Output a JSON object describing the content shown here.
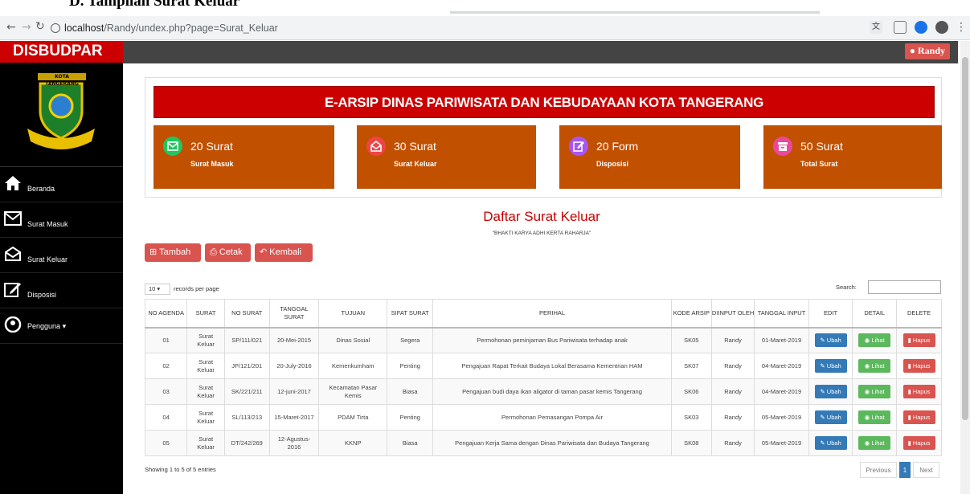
{
  "doc_heading": "D. Tampilan Surat Keluar",
  "browser": {
    "url_host": "localhost",
    "url_path": "/Randy/undex.php?page=Surat_Keluar"
  },
  "app": {
    "brand": "DISBUDPAR",
    "logo_text": "KOTA TANGERANG",
    "user_button": "Randy",
    "colors": {
      "brand": "#cc0000",
      "stat_card": "#c15000",
      "sidebar": "#000000",
      "topbar": "#444444"
    }
  },
  "sidebar": {
    "items": [
      {
        "label": "Beranda",
        "icon": "home-icon"
      },
      {
        "label": "Surat Masuk",
        "icon": "envelope-icon"
      },
      {
        "label": "Surat Keluar",
        "icon": "envelope-open-icon"
      },
      {
        "label": "Disposisi",
        "icon": "edit-icon"
      },
      {
        "label": "Pengguna",
        "icon": "user-circle-icon",
        "caret": "▾"
      }
    ]
  },
  "banner": "E-ARSIP DINAS PARIWISATA DAN KEBUDAYAAN KOTA TANGERANG",
  "stats": [
    {
      "count": "20 Surat",
      "label": "Surat Masuk",
      "icon": "envelope-icon",
      "color": "#22c55e"
    },
    {
      "count": "30 Surat",
      "label": "Surat Keluar",
      "icon": "envelope-open-icon",
      "color": "#ef4444"
    },
    {
      "count": "20 Form",
      "label": "Disposisi",
      "icon": "edit-icon",
      "color": "#a855f7"
    },
    {
      "count": "50 Surat",
      "label": "Total Surat",
      "icon": "archive-icon",
      "color": "#ec4899"
    }
  ],
  "page": {
    "title": "Daftar Surat Keluar",
    "subtitle": "\"BHAKTI KARYA ADHI KERTA RAHARJA\""
  },
  "actions": {
    "add": "Tambah",
    "print": "Cetak",
    "back": "Kembali"
  },
  "table_controls": {
    "page_size": "10",
    "records_label": "records per page",
    "search_label": "Search:"
  },
  "table": {
    "headers": [
      "NO AGENDA",
      "SURAT",
      "NO SURAT",
      "TANGGAL SURAT",
      "TUJUAN",
      "SIFAT SURAT",
      "PERIHAL",
      "KODE ARSIP",
      "DIINPUT OLEH",
      "TANGGAL INPUT",
      "EDIT",
      "DETAIL",
      "DELETE"
    ],
    "rows": [
      {
        "no": "01",
        "surat": "Surat Keluar",
        "no_surat": "SP/111/021",
        "tanggal": "20-Mei-2015",
        "tujuan": "Dinas Sosial",
        "sifat": "Segera",
        "perihal": "Permohonan peminjaman Bus Pariwisata terhadap anak",
        "kode": "SK05",
        "oleh": "Randy",
        "input": "01-Maret-2019"
      },
      {
        "no": "02",
        "surat": "Surat Keluar",
        "no_surat": "JP/121/201",
        "tanggal": "20-July-2016",
        "tujuan": "Kemenkumham",
        "sifat": "Penting",
        "perihal": "Pengajuan Rapat Terkait Budaya Lokal Berasama Kementrian HAM",
        "kode": "SK07",
        "oleh": "Randy",
        "input": "04-Maret-2019"
      },
      {
        "no": "03",
        "surat": "Surat Keluar",
        "no_surat": "SK/221/211",
        "tanggal": "12-juni-2017",
        "tujuan": "Kecamatan Pasar Kemis",
        "sifat": "Biasa",
        "perihal": "Pengajuan budi daya ikan aligator di taman pasar kemis Tangerang",
        "kode": "SK06",
        "oleh": "Randy",
        "input": "04-Maret-2019"
      },
      {
        "no": "04",
        "surat": "Surat Keluar",
        "no_surat": "SL/113/213",
        "tanggal": "15-Maret-2017",
        "tujuan": "PDAM Tirta",
        "sifat": "Penting",
        "perihal": "Permohonan Pemasangan Pompa Air",
        "kode": "SK03",
        "oleh": "Randy",
        "input": "05-Maret-2019"
      },
      {
        "no": "05",
        "surat": "Surat Keluar",
        "no_surat": "DT/242/269",
        "tanggal": "12-Agustus-2016",
        "tujuan": "KKNP",
        "sifat": "Biasa",
        "perihal": "Pengajuan Kerja Sama dengan Dinas Pariwisata dan Budaya Tangerang",
        "kode": "SK08",
        "oleh": "Randy",
        "input": "05-Maret-2019"
      }
    ],
    "row_buttons": {
      "edit": "Ubah",
      "detail": "Lihat",
      "delete": "Hapus"
    }
  },
  "footer": {
    "info": "Showing 1 to 5 of 5 entries",
    "prev": "Previous",
    "page": "1",
    "next": "Next"
  }
}
